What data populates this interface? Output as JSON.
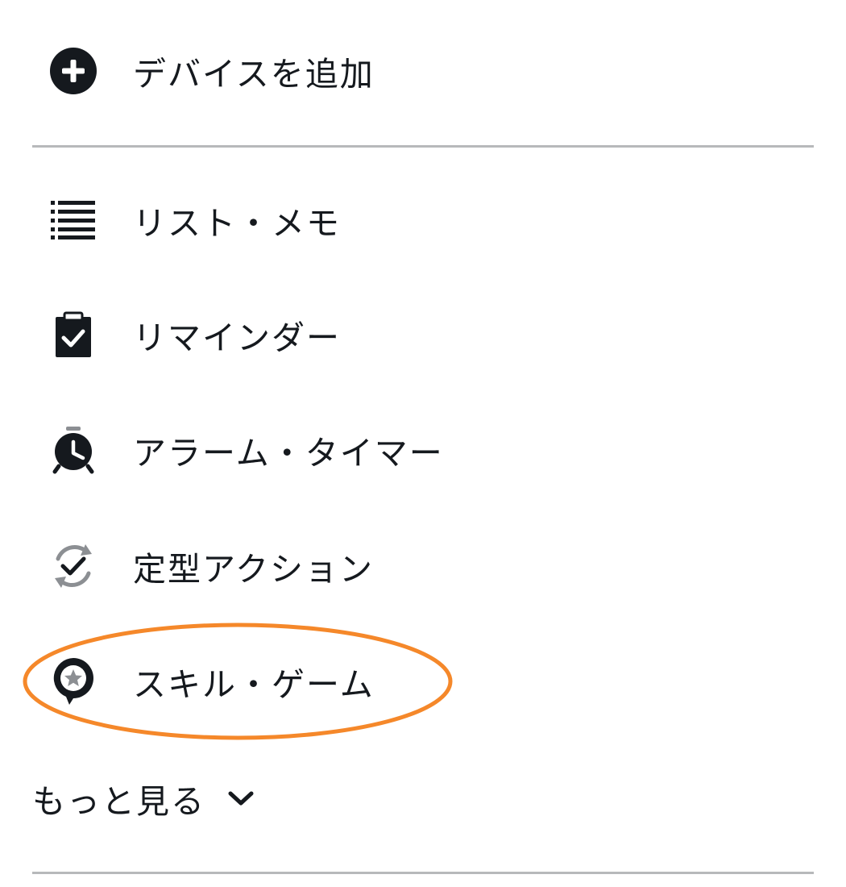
{
  "menu": {
    "add_device": {
      "label": "デバイスを追加",
      "icon": "add-circle-icon"
    },
    "items": [
      {
        "label": "リスト・メモ",
        "icon": "list-icon"
      },
      {
        "label": "リマインダー",
        "icon": "clipboard-check-icon"
      },
      {
        "label": "アラーム・タイマー",
        "icon": "alarm-clock-icon"
      },
      {
        "label": "定型アクション",
        "icon": "routine-sync-check-icon"
      },
      {
        "label": "スキル・ゲーム",
        "icon": "skill-star-bubble-icon",
        "highlighted": true
      }
    ],
    "more": {
      "label": "もっと見る",
      "icon": "chevron-down-icon"
    }
  },
  "colors": {
    "text": "#15191e",
    "icon": "#15191e",
    "divider": "#b7b9bb",
    "highlight": "#f5882a",
    "routine_arrows": "#8c8f93"
  }
}
